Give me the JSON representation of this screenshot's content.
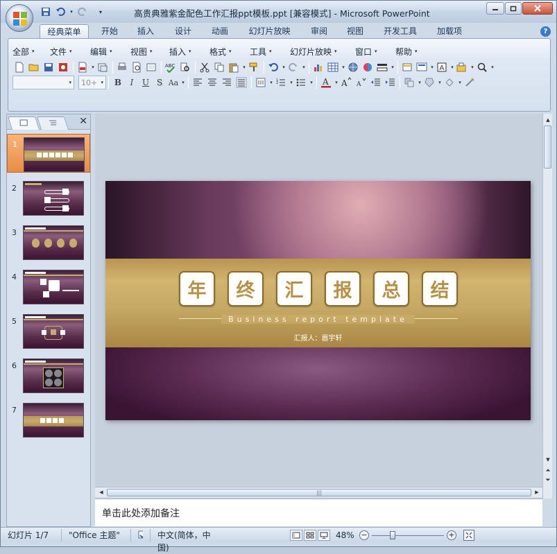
{
  "window": {
    "title": "高贵典雅紫金配色工作汇报ppt模板.ppt [兼容模式] - Microsoft PowerPoint"
  },
  "ribbon_tabs": [
    {
      "label": "经典菜单",
      "active": true
    },
    {
      "label": "开始"
    },
    {
      "label": "插入"
    },
    {
      "label": "设计"
    },
    {
      "label": "动画"
    },
    {
      "label": "幻灯片放映"
    },
    {
      "label": "审阅"
    },
    {
      "label": "视图"
    },
    {
      "label": "开发工具"
    },
    {
      "label": "加载项"
    }
  ],
  "classic_menu": [
    "全部",
    "文件",
    "编辑",
    "视图",
    "插入",
    "格式",
    "工具",
    "幻灯片放映",
    "窗口",
    "帮助"
  ],
  "font_combo": {
    "name": "",
    "size": "10+"
  },
  "slides_pane": {
    "slides": [
      "1",
      "2",
      "3",
      "4",
      "5",
      "6",
      "7"
    ],
    "selected": 1
  },
  "slide": {
    "chars": [
      "年",
      "终",
      "汇",
      "报",
      "总",
      "结"
    ],
    "subtitle": "Business report template",
    "reporter": "汇报人：嚣宇轩"
  },
  "notes": {
    "placeholder": "单击此处添加备注"
  },
  "status": {
    "slide_counter": "幻灯片 1/7",
    "theme": "\"Office 主题\"",
    "language": "中文(简体，中国)",
    "zoom": "48%"
  },
  "colors": {
    "gold": "#c6a964",
    "purple": "#5f2d55",
    "selection": "#e88d44"
  }
}
